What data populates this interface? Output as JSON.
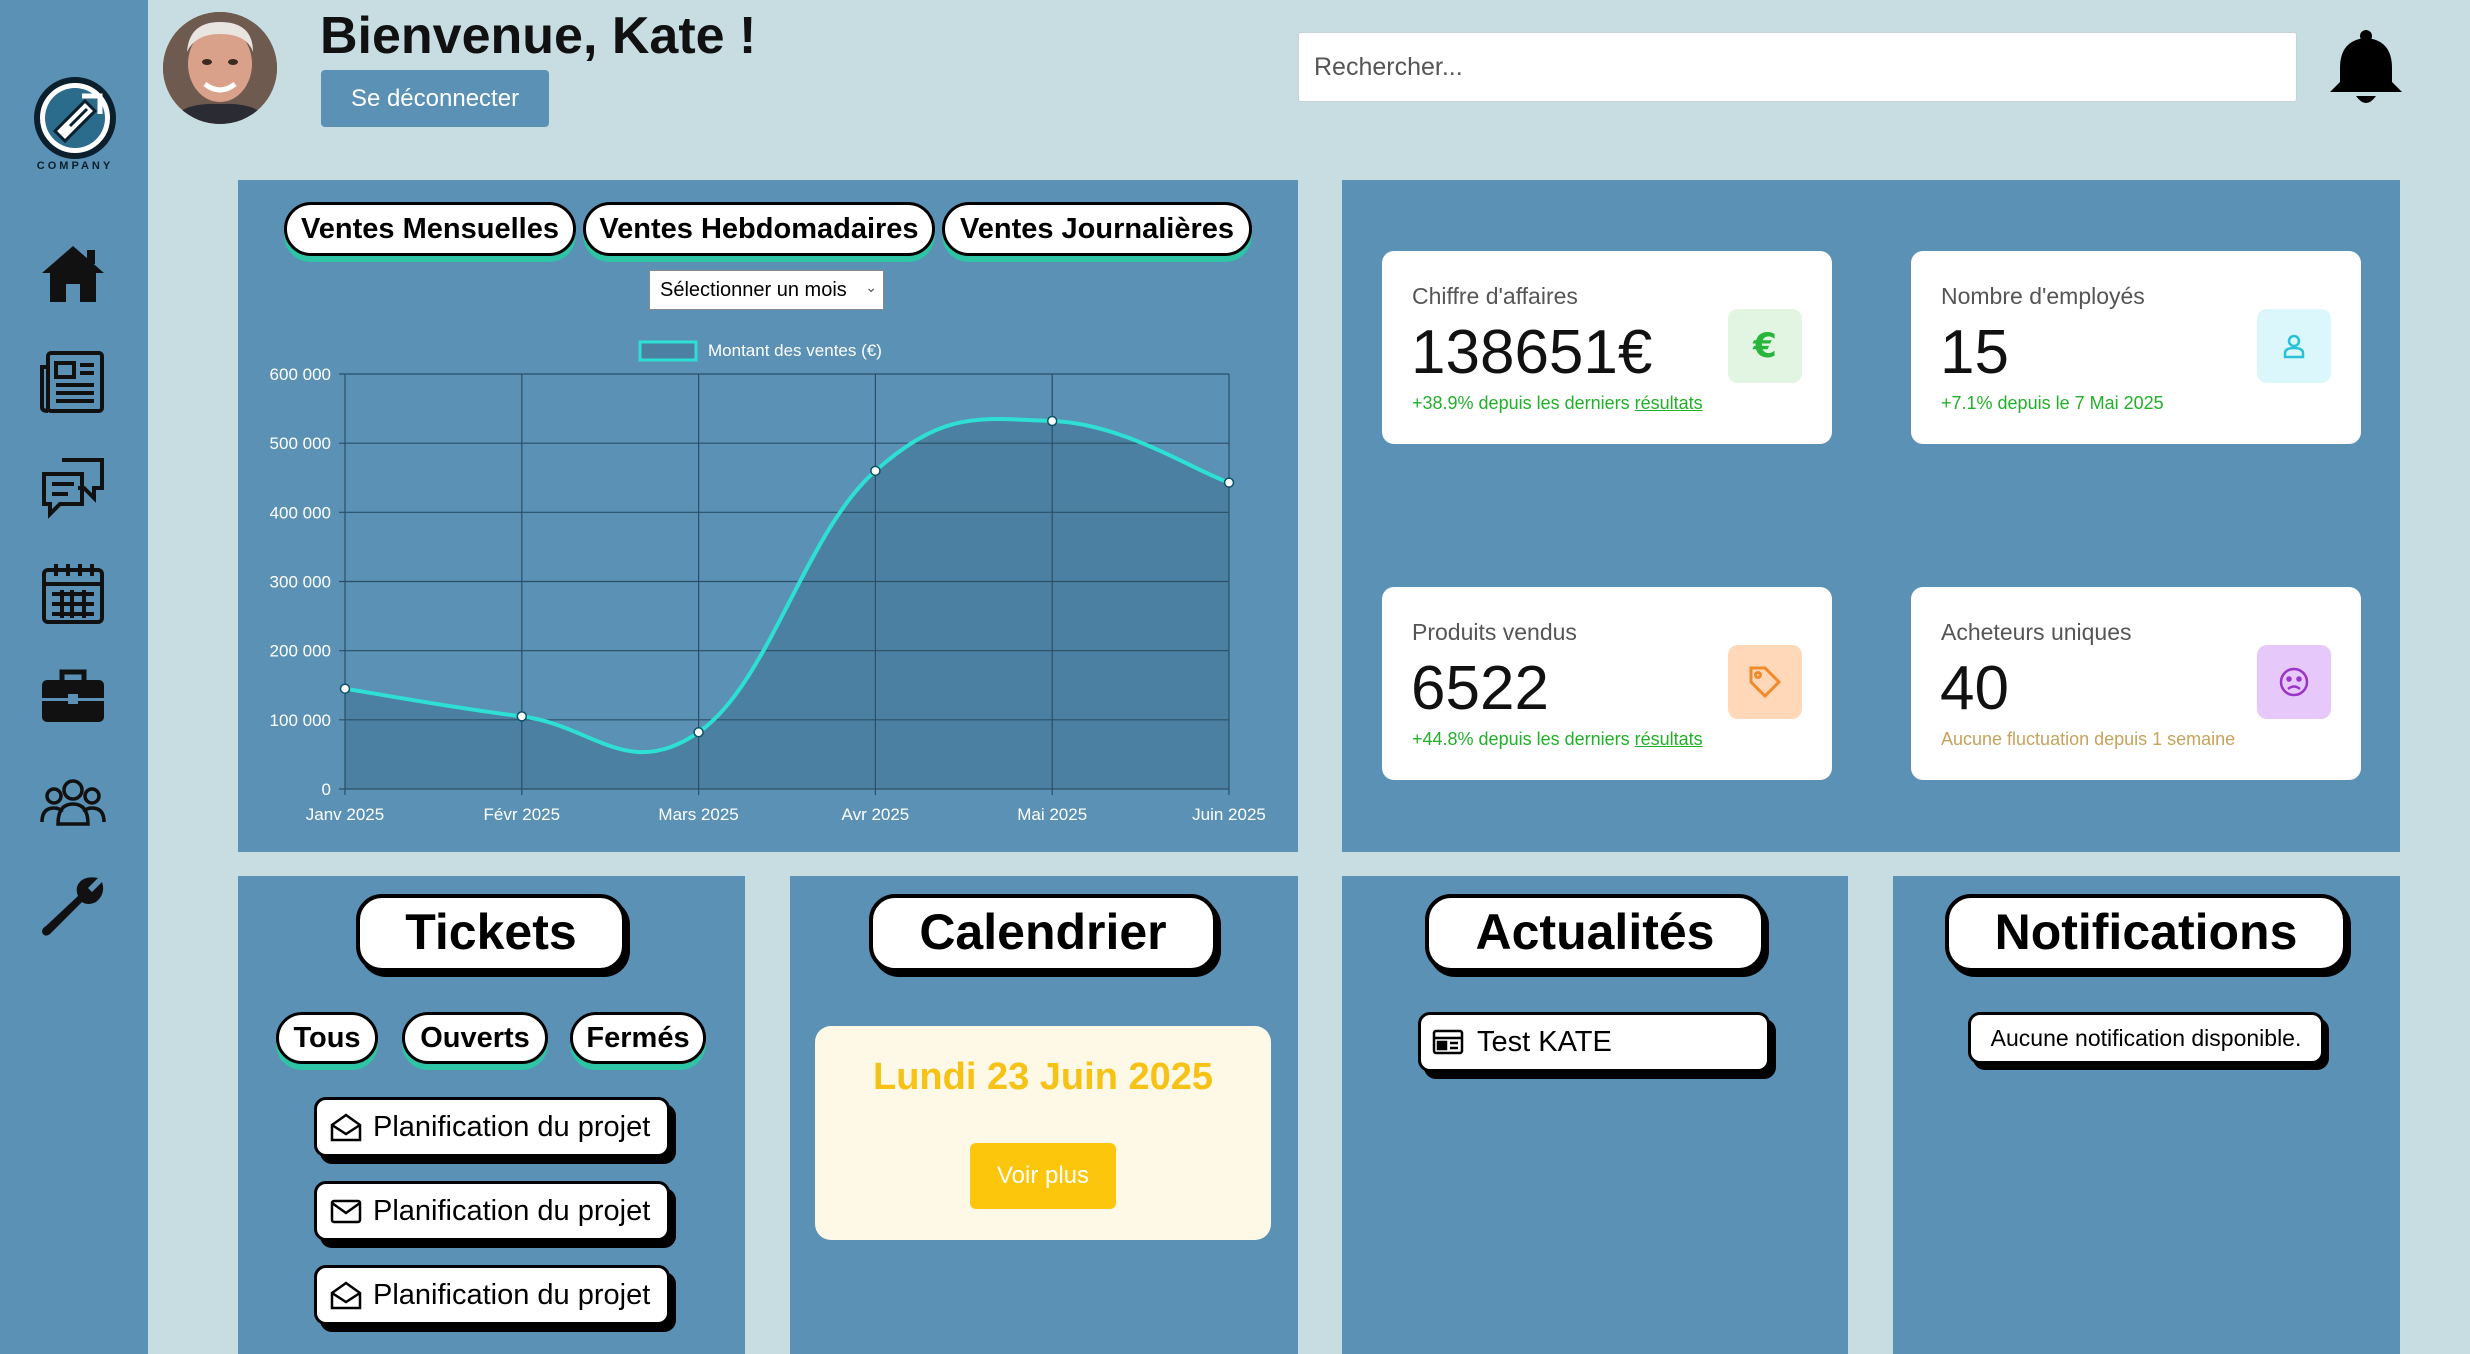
{
  "sidebar": {
    "logo_text": "COMPANY",
    "items": [
      {
        "icon": "home-icon"
      },
      {
        "icon": "newspaper-icon"
      },
      {
        "icon": "chat-icon"
      },
      {
        "icon": "calendar-icon"
      },
      {
        "icon": "briefcase-icon"
      },
      {
        "icon": "users-icon"
      },
      {
        "icon": "wrench-icon"
      }
    ]
  },
  "header": {
    "welcome": "Bienvenue, Kate !",
    "logout_label": "Se déconnecter",
    "search_placeholder": "Rechercher..."
  },
  "chart_panel": {
    "tabs": [
      "Ventes Mensuelles",
      "Ventes Hebdomadaires",
      "Ventes Journalières"
    ],
    "select_label": "Sélectionner un mois"
  },
  "chart_data": {
    "type": "line",
    "x": [
      "Janv 2025",
      "Févr 2025",
      "Mars 2025",
      "Avr 2025",
      "Mai 2025",
      "Juin 2025"
    ],
    "series": [
      {
        "name": "Montant des ventes (€)",
        "values": [
          145000,
          105000,
          82000,
          460000,
          532000,
          443000
        ]
      }
    ],
    "ylim": [
      0,
      600000
    ],
    "yticks": [
      "600 000",
      "500 000",
      "400 000",
      "300 000",
      "200 000",
      "100 000",
      "0"
    ],
    "grid": true,
    "legend": "top-center",
    "colors": {
      "line": "#2de0d3",
      "fill": "#4c80a2",
      "grid": "#2a4f66"
    }
  },
  "kpis": [
    {
      "label": "Chiffre d'affaires",
      "value": "138651€",
      "change_prefix": "+38.9% depuis les derniers ",
      "change_suffix": "résultats",
      "icon": "euro-icon",
      "icon_bg": "#e2f5e2",
      "icon_color": "#27b53a"
    },
    {
      "label": "Nombre d'employés",
      "value": "15",
      "change_prefix": "+7.1% depuis le 7 Mai 2025",
      "change_suffix": "",
      "icon": "person-icon",
      "icon_bg": "#dcf7fb",
      "icon_color": "#27c2d8"
    },
    {
      "label": "Produits vendus",
      "value": "6522",
      "change_prefix": "+44.8% depuis les derniers ",
      "change_suffix": "résultats",
      "icon": "tag-icon",
      "icon_bg": "#fed8b8",
      "icon_color": "#f08a2a"
    },
    {
      "label": "Acheteurs uniques",
      "value": "40",
      "change_prefix": "Aucune fluctuation depuis 1 semaine",
      "change_suffix": "",
      "icon": "sad-face-icon",
      "icon_bg": "#e6c8fa",
      "icon_color": "#9a35c8"
    }
  ],
  "tickets": {
    "title": "Tickets",
    "filters": [
      "Tous",
      "Ouverts",
      "Fermés"
    ],
    "items": [
      {
        "label": "Planification du projet",
        "icon": "envelope-open-icon"
      },
      {
        "label": "Planification du projet",
        "icon": "envelope-icon"
      },
      {
        "label": "Planification du projet",
        "icon": "envelope-open-icon"
      }
    ]
  },
  "calendar": {
    "title": "Calendrier",
    "date": "Lundi 23 Juin 2025",
    "more_label": "Voir plus"
  },
  "news": {
    "title": "Actualités",
    "items": [
      {
        "label": "Test KATE",
        "icon": "newspaper-icon"
      }
    ]
  },
  "notifications": {
    "title": "Notifications",
    "empty": "Aucune notification disponible."
  }
}
